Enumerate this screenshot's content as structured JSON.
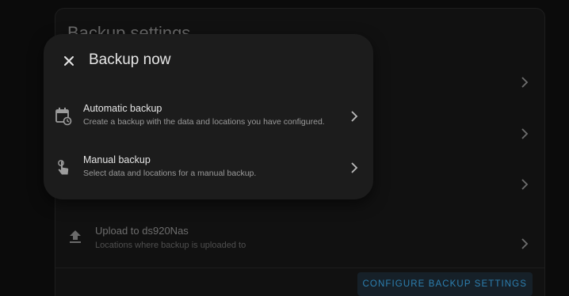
{
  "card": {
    "title": "Backup settings"
  },
  "upload": {
    "title": "Upload to ds920Nas",
    "subtitle": "Locations where backup is uploaded to"
  },
  "configure_button_label": "CONFIGURE BACKUP SETTINGS",
  "dialog": {
    "title": "Backup now",
    "options": [
      {
        "title": "Automatic backup",
        "subtitle": "Create a backup with the data and locations you have configured.",
        "icon": "calendar-sync-icon"
      },
      {
        "title": "Manual backup",
        "subtitle": "Select data and locations for a manual backup.",
        "icon": "gesture-tap-icon"
      }
    ]
  },
  "colors": {
    "background": "#0b0b0b",
    "card": "#111111",
    "dialog": "#1c1c1c",
    "accent": "#2d7fb0"
  }
}
